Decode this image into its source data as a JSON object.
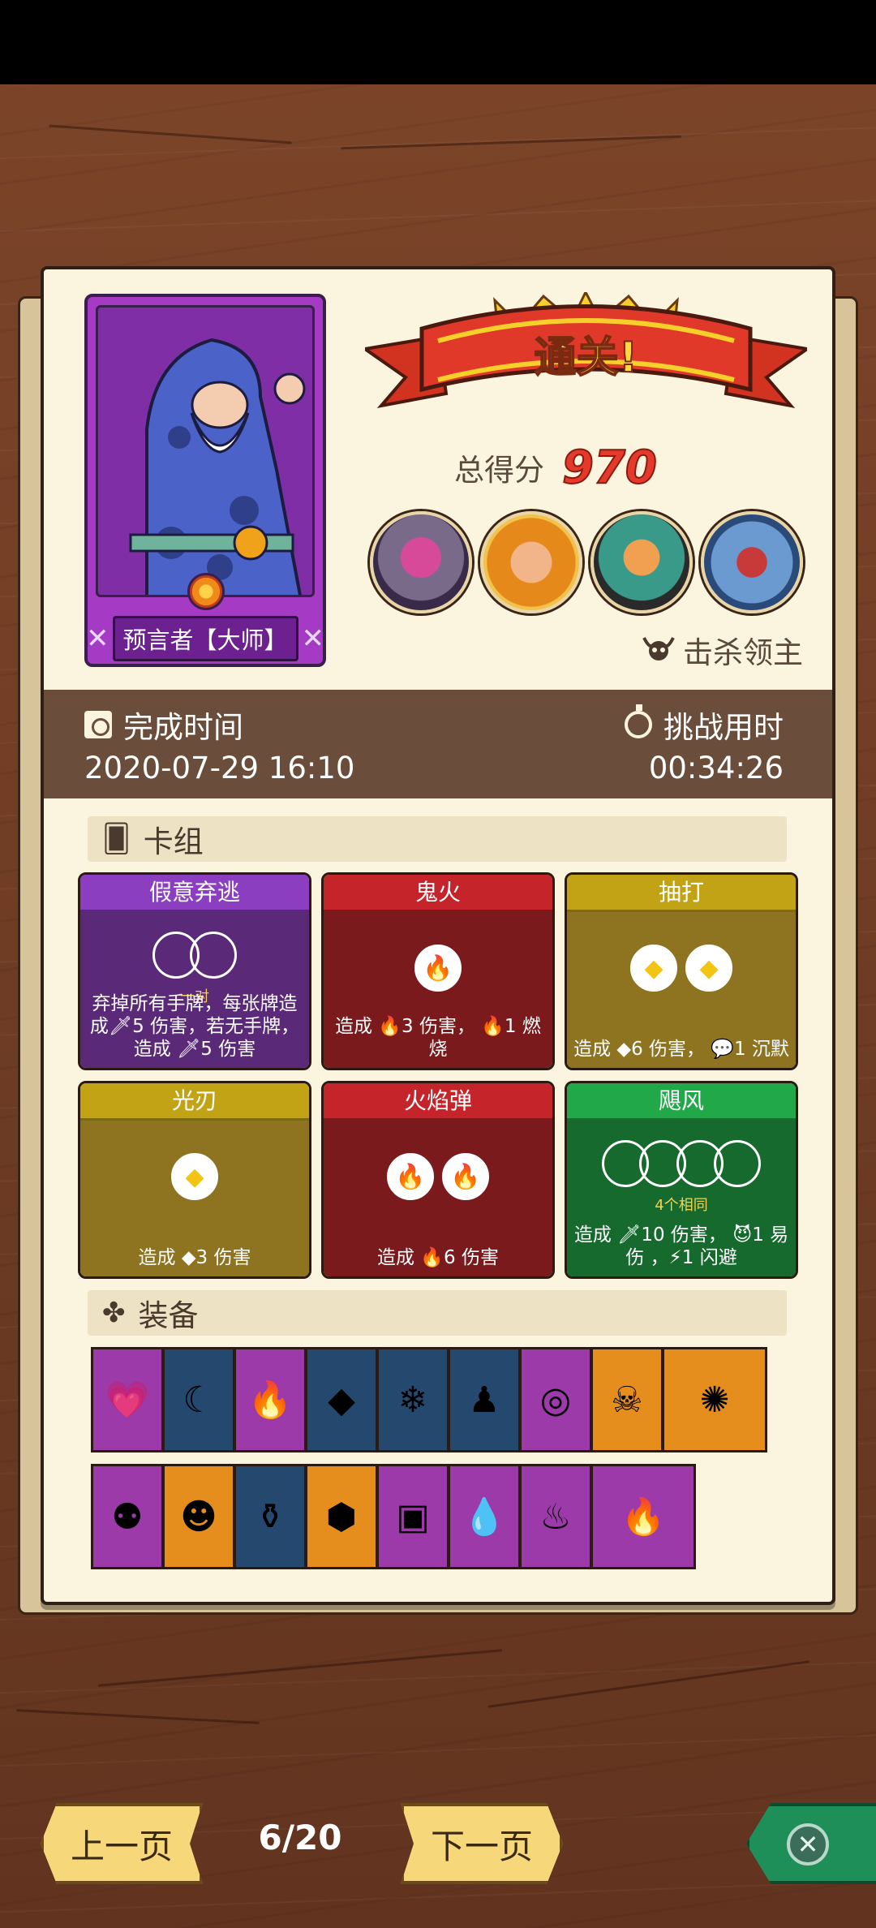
{
  "hero": {
    "name": "预言者【大师】"
  },
  "result": {
    "banner": "通关!",
    "score_label": "总得分",
    "score_value": "970",
    "boss_kill_label": "击杀领主"
  },
  "times": {
    "finish_label": "完成时间",
    "finish_value": "2020-07-29 16:10",
    "duration_label": "挑战用时",
    "duration_value": "00:34:26"
  },
  "deck": {
    "title": "卡组",
    "cards": [
      {
        "name": "假意弃逃",
        "sub": "一对",
        "desc": "弃掉所有手牌，每张牌造成🗡5 伤害，若无手牌，造成 🗡5 伤害"
      },
      {
        "name": "鬼火",
        "desc": "造成 🔥3 伤害， 🔥1 燃烧"
      },
      {
        "name": "抽打",
        "desc": "造成 ◆6 伤害， 💬1 沉默"
      },
      {
        "name": "光刃",
        "desc": "造成 ◆3 伤害"
      },
      {
        "name": "火焰弹",
        "desc": "造成 🔥6 伤害"
      },
      {
        "name": "飓风",
        "sub": "4个相同",
        "desc": "造成 🗡10 伤害， 😈1 易伤 ，⚡1 闪避"
      }
    ]
  },
  "equipment": {
    "title": "装备"
  },
  "nav": {
    "prev": "上一页",
    "page": "6/20",
    "next": "下一页",
    "close": "✕"
  }
}
